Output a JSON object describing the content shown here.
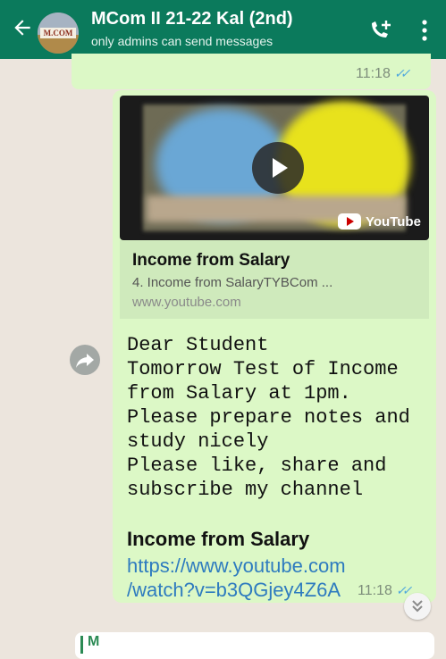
{
  "header": {
    "title": "MCom II 21-22 Kal (2nd)",
    "subtitle": "only admins can send messages",
    "avatar_text": "M.COM",
    "back_icon": "back-arrow-icon",
    "call_icon": "add-call-icon",
    "menu_icon": "more-vertical-icon",
    "color": "#0b7a5c"
  },
  "previous_message": {
    "time": "11:18"
  },
  "message": {
    "thumbnail_badge": "YouTube",
    "preview_title": "Income from Salary",
    "preview_description": "4. Income from SalaryTYBCom ...",
    "preview_domain": "www.youtube.com",
    "text": "Dear Student\nTomorrow Test of Income\nfrom Salary at 1pm.\nPlease prepare notes and\nstudy nicely\nPlease like, share and\nsubscribe my channel",
    "link_title": "Income from Salary",
    "link_line1": "https://www.youtube.com",
    "link_line2": "/watch?v=b3QGjey4Z6A",
    "time": "11:18",
    "bubble_color": "#dcf8c6",
    "link_color": "#2e7bbf"
  },
  "next_message": {
    "preview": "M"
  }
}
